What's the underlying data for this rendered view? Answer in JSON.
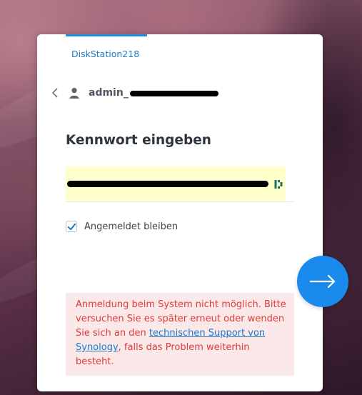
{
  "login": {
    "device_name": "DiskStation218",
    "username_prefix": "admin_",
    "title": "Kennwort eingeben",
    "remember_label": "Angemeldet bleiben",
    "remember_checked": true,
    "error": {
      "before_link": "Anmeldung beim System nicht möglich. Bitte versuchen Sie es später erneut oder wenden Sie sich an den ",
      "link_text": "technischen Support von Synology",
      "after_link": ", falls das Problem weiterhin besteht."
    }
  },
  "colors": {
    "accent": "#1a8aec",
    "error_text": "#e03a3a",
    "error_bg": "#fbe8e8",
    "autofill_bg": "#ffffcc"
  },
  "icons": {
    "back": "chevron-left-icon",
    "user": "user-icon",
    "password_manager": "password-manager-icon",
    "checkbox": "checkmark-icon",
    "next": "arrow-right-icon"
  }
}
